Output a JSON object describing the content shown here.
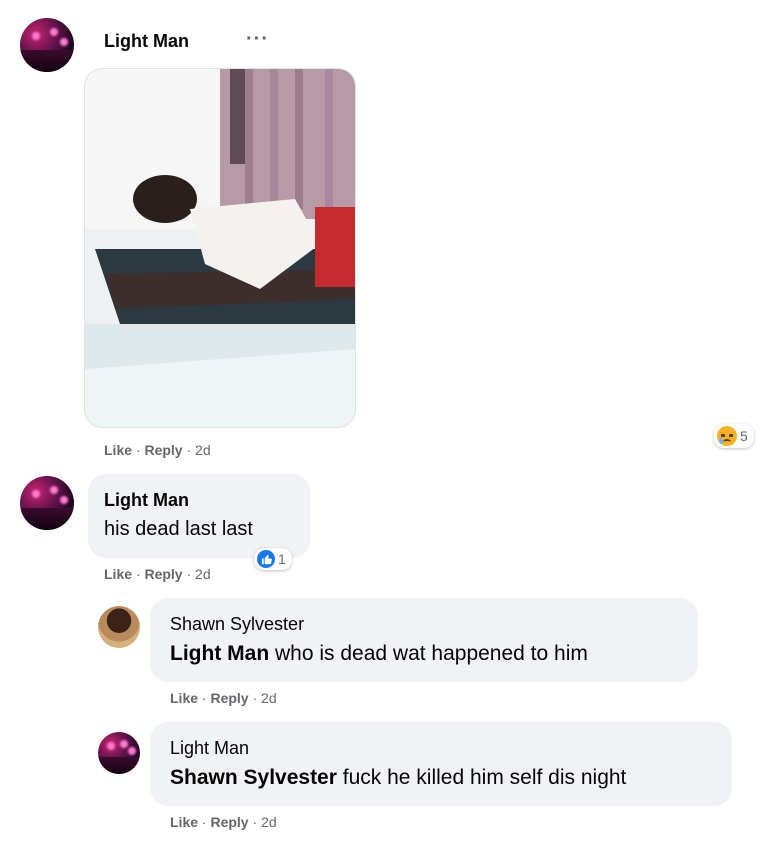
{
  "post_comment": {
    "author": "Light Man",
    "more_label": "···",
    "actions": {
      "like": "Like",
      "reply": "Reply",
      "time": "2d"
    },
    "reaction_count": "5",
    "reaction_icon": "sad-icon"
  },
  "comments": [
    {
      "author": "Light Man",
      "text": "his dead last last",
      "actions": {
        "like": "Like",
        "reply": "Reply",
        "time": "2d"
      },
      "reaction_count": "1",
      "reaction_icon": "like-icon"
    }
  ],
  "replies": [
    {
      "author": "Shawn Sylvester",
      "mention": "Light Man",
      "text": " who is dead wat happened to him",
      "actions": {
        "like": "Like",
        "reply": "Reply",
        "time": "2d"
      }
    },
    {
      "author": "Light Man",
      "mention": "Shawn Sylvester",
      "text": " fuck he killed him self dis night",
      "actions": {
        "like": "Like",
        "reply": "Reply",
        "time": "2d"
      }
    }
  ],
  "colors": {
    "bubble": "#f0f2f5",
    "meta_text": "#65676b",
    "like_blue": "#1877f2",
    "sad_yellow": "#f7b125"
  }
}
